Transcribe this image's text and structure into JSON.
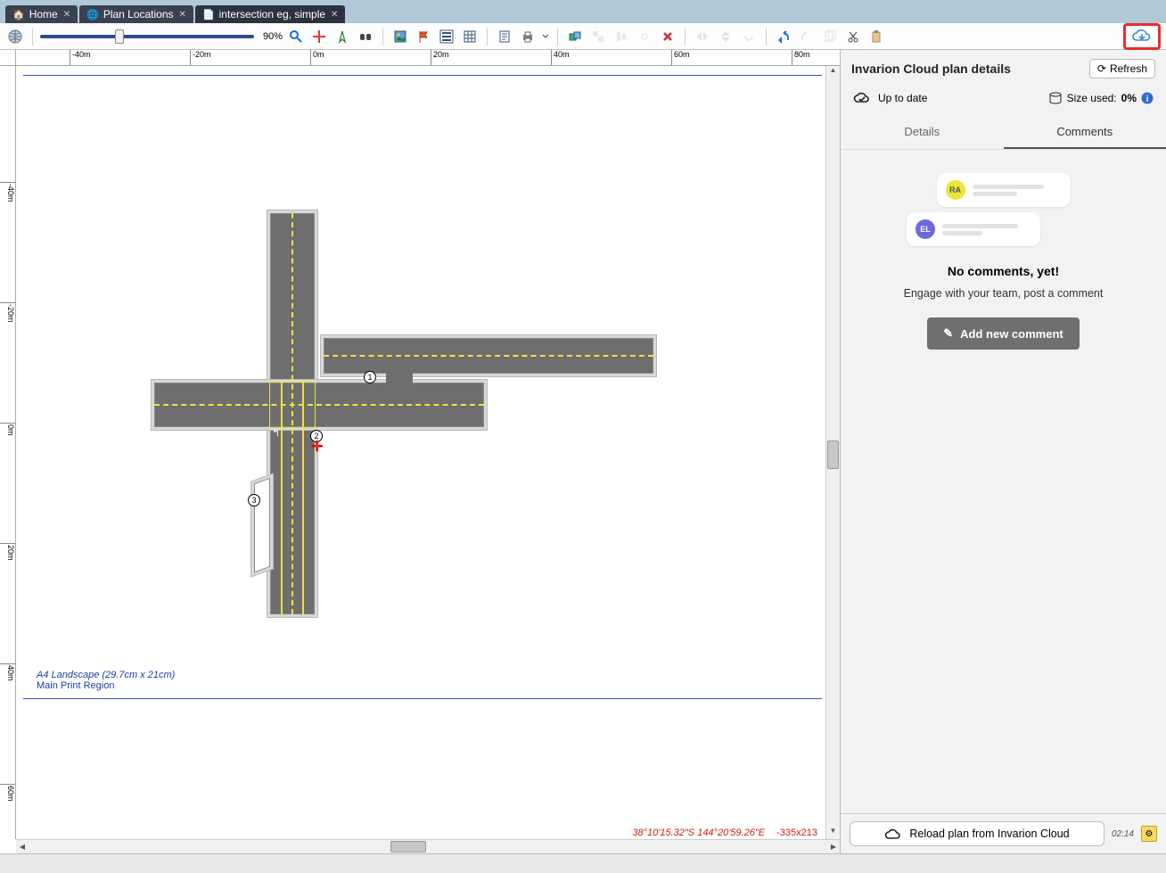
{
  "tabs": [
    {
      "label": "Home",
      "icon": "home"
    },
    {
      "label": "Plan Locations",
      "icon": "globe"
    },
    {
      "label": "intersection eg, simple",
      "icon": "doc"
    }
  ],
  "toolbar": {
    "zoom": "90%",
    "ruler_h": [
      "-40m",
      "-20m",
      "0m",
      "20m",
      "40m",
      "60m",
      "80m"
    ],
    "ruler_v": [
      "-40m",
      "-20m",
      "0m",
      "20m",
      "40m",
      "60m"
    ]
  },
  "canvas": {
    "page_format": "A4 Landscape (29.7cm x 21cm)",
    "region_label": "Main Print Region",
    "markers": [
      "1",
      "2",
      "3"
    ],
    "gps": "38°10'15.32\"S 144°20'59.26\"E",
    "cursor_size": "-335x213"
  },
  "panel": {
    "title": "Invarion Cloud plan details",
    "refresh": "Refresh",
    "status_text": "Up to date",
    "size_label": "Size used:",
    "size_value": "0%",
    "tabs": [
      "Details",
      "Comments"
    ],
    "avatars": [
      "RA",
      "EL"
    ],
    "no_comments": "No comments, yet!",
    "engage": "Engage with your team, post a comment",
    "add_comment": "Add new comment",
    "reload": "Reload plan from Invarion Cloud",
    "time": "02:14"
  }
}
